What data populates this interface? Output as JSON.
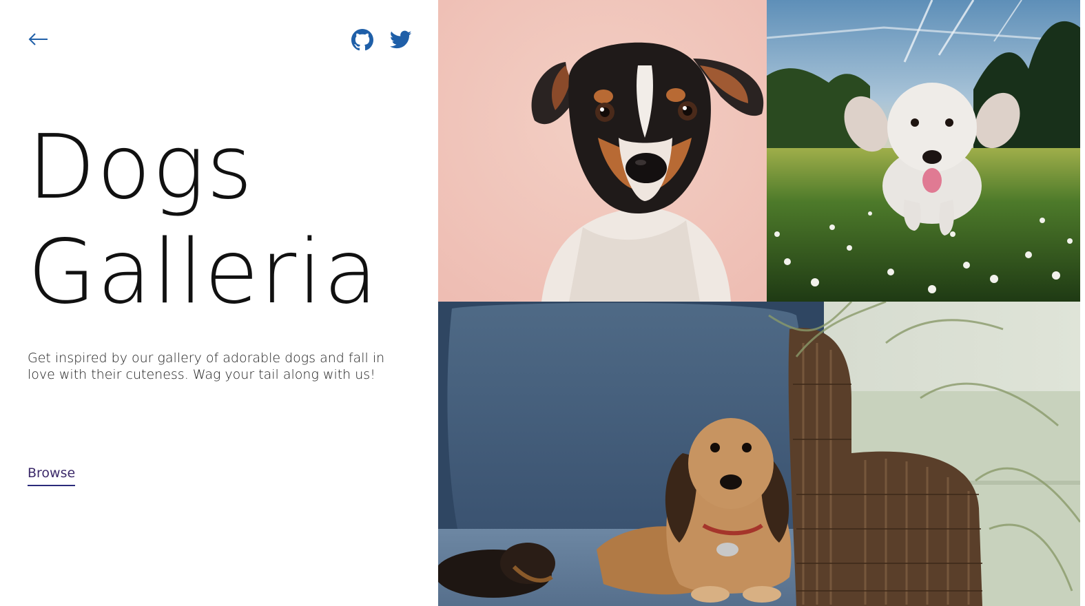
{
  "header": {
    "back_icon": "arrow-left-icon",
    "social": [
      {
        "name": "GitHub",
        "icon": "github-icon"
      },
      {
        "name": "Twitter",
        "icon": "twitter-icon"
      }
    ],
    "accent_color": "#1f5fa8"
  },
  "hero": {
    "title_line1": "Dogs",
    "title_line2": "Galleria",
    "description": "Get inspired by our gallery of adorable dogs and fall in love with their cuteness. Wag your tail along with us!",
    "browse_label": "Browse"
  },
  "gallery": {
    "images": [
      {
        "subject": "dog-portrait-pink-background"
      },
      {
        "subject": "white-dog-running-on-grass"
      },
      {
        "subject": "dachshunds-on-couch"
      }
    ]
  }
}
